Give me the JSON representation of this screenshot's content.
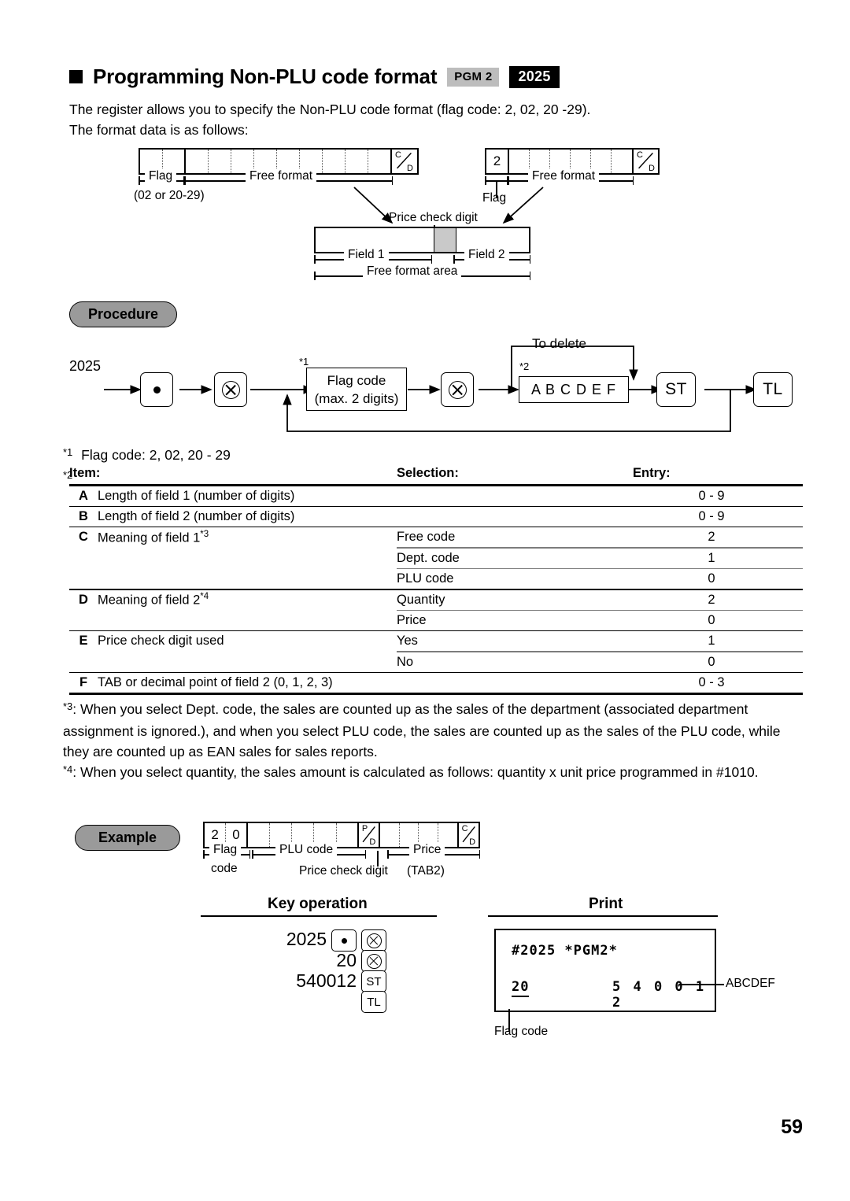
{
  "header": {
    "title": "Programming Non-PLU code format",
    "badge_mode": "PGM 2",
    "badge_code": "2025",
    "bullet_icon": "filled-square-bullet"
  },
  "intro": {
    "line1": "The register allows you to specify the Non-PLU code format (flag code: 2, 02, 20 -29).",
    "line2": "The format data is as follows:"
  },
  "format_diagram": {
    "left_box": {
      "flag_cells": 2,
      "free_cells": 9,
      "check_digit": {
        "top": "C",
        "bottom": "D"
      },
      "flag_label": "Flag",
      "flag_sub": "(02 or 20-29)",
      "free_label": "Free format"
    },
    "right_box": {
      "flag_value": "2",
      "free_cells": 6,
      "check_digit": {
        "top": "C",
        "bottom": "D"
      },
      "flag_label": "Flag",
      "free_label": "Free format"
    },
    "detail": {
      "price_check_label": "Price check digit",
      "field1_label": "Field 1",
      "field2_label": "Field 2",
      "area_label": "Free format area"
    }
  },
  "procedure": {
    "section_label": "Procedure",
    "start_value": "2025",
    "key_point": "point-key",
    "key_multiply": "multiply-key",
    "flag_box": {
      "line1": "Flag code",
      "line2": "(max. 2 digits)",
      "note": "*1"
    },
    "abcdef_box": {
      "label": "A B C D E F",
      "note": "*2"
    },
    "to_delete_label": "To delete",
    "key_st": "ST",
    "key_tl": "TL"
  },
  "notes": {
    "n1_marker": "*1",
    "n1_text": "Flag code: 2, 02, 20 - 29",
    "n2_marker": "*2"
  },
  "table": {
    "headers": {
      "item": "Item:",
      "selection": "Selection:",
      "entry": "Entry:"
    },
    "rows": [
      {
        "item": "A",
        "desc": "Length of field 1 (number of digits)",
        "sup": "",
        "selection": "",
        "entry": "0 - 9"
      },
      {
        "item": "B",
        "desc": "Length of field 2 (number of digits)",
        "sup": "",
        "selection": "",
        "entry": "0 - 9"
      },
      {
        "item": "C",
        "desc": "Meaning of field 1",
        "sup": "*3",
        "selection": "Free code",
        "entry": "2"
      },
      {
        "item": "",
        "desc": "",
        "sup": "",
        "selection": "Dept. code",
        "entry": "1"
      },
      {
        "item": "",
        "desc": "",
        "sup": "",
        "selection": "PLU code",
        "entry": "0"
      },
      {
        "item": "D",
        "desc": "Meaning of field 2",
        "sup": "*4",
        "selection": "Quantity",
        "entry": "2"
      },
      {
        "item": "",
        "desc": "",
        "sup": "",
        "selection": "Price",
        "entry": "0"
      },
      {
        "item": "E",
        "desc": "Price check digit used",
        "sup": "",
        "selection": "Yes",
        "entry": "1"
      },
      {
        "item": "",
        "desc": "",
        "sup": "",
        "selection": "No",
        "entry": "0"
      },
      {
        "item": "F",
        "desc": "TAB or decimal point of field 2 (0, 1, 2, 3)",
        "sup": "",
        "selection": "",
        "entry": "0 - 3"
      }
    ]
  },
  "footnotes": {
    "n3_marker": "*3",
    "n3_text": ": When you select Dept. code, the sales are counted up as the sales of the department (associated department assignment is ignored.), and when you select PLU code, the sales are counted up as the sales of the PLU code, while they are counted up as EAN sales for sales reports.",
    "n4_marker": "*4",
    "n4_text": ": When you select quantity, the sales amount is calculated as follows:  quantity x unit price programmed in #1010."
  },
  "example": {
    "section_label": "Example",
    "box": {
      "flag_digits": [
        "2",
        "0"
      ],
      "plu_cells": 5,
      "price_digit": {
        "top": "P",
        "bottom": "D"
      },
      "price_cells": 4,
      "check_digit": {
        "top": "C",
        "bottom": "D"
      },
      "flag_label_line1": "Flag",
      "flag_label_line2": "code",
      "plu_label": "PLU code",
      "price_check_label": "Price check digit",
      "price_label": "Price",
      "tab_label": "(TAB2)"
    },
    "key_operation_title": "Key operation",
    "key_rows": [
      {
        "value": "2025",
        "keys": [
          "point-key",
          "multiply-key"
        ]
      },
      {
        "value": "20",
        "keys": [
          "multiply-key"
        ]
      },
      {
        "value": "540012",
        "keys": [
          "ST"
        ]
      },
      {
        "value": "",
        "keys": [
          "TL"
        ]
      }
    ],
    "print_title": "Print",
    "receipt": {
      "line1": "#2025 *PGM2*",
      "flag": "20",
      "digits": "5 4 0 0 1 2"
    },
    "callout_abcdef": "ABCDEF",
    "callout_flag": "Flag code"
  },
  "footer": {
    "page_number": "59"
  }
}
